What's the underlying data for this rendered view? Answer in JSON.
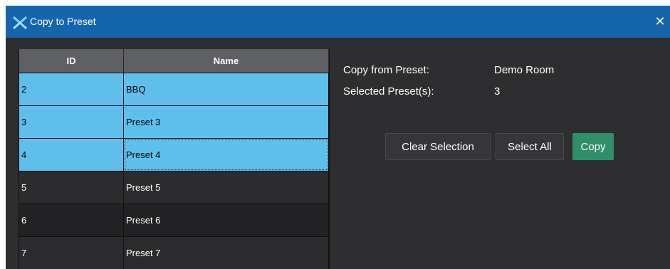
{
  "window": {
    "title": "Copy to Preset",
    "close_glyph": "✕"
  },
  "table": {
    "columns": [
      "ID",
      "Name"
    ],
    "rows": [
      {
        "id": "2",
        "name": "BBQ",
        "selected": true
      },
      {
        "id": "3",
        "name": "Preset 3",
        "selected": true
      },
      {
        "id": "4",
        "name": "Preset 4",
        "selected": true
      },
      {
        "id": "5",
        "name": "Preset 5",
        "selected": false
      },
      {
        "id": "6",
        "name": "Preset 6",
        "selected": false
      },
      {
        "id": "7",
        "name": "Preset 7",
        "selected": false
      }
    ]
  },
  "info": {
    "copy_from_label": "Copy from Preset:",
    "copy_from_value": "Demo Room",
    "selected_label": "Selected Preset(s):",
    "selected_value": "3"
  },
  "buttons": {
    "clear": "Clear Selection",
    "select_all": "Select All",
    "copy": "Copy"
  },
  "colors": {
    "titlebar": "#1565ad",
    "selected_row": "#5fbfec",
    "copy_button": "#2f8f6a",
    "body": "#2e2e30"
  },
  "icons": {
    "app": "app-x-logo-icon",
    "close": "close-icon"
  }
}
